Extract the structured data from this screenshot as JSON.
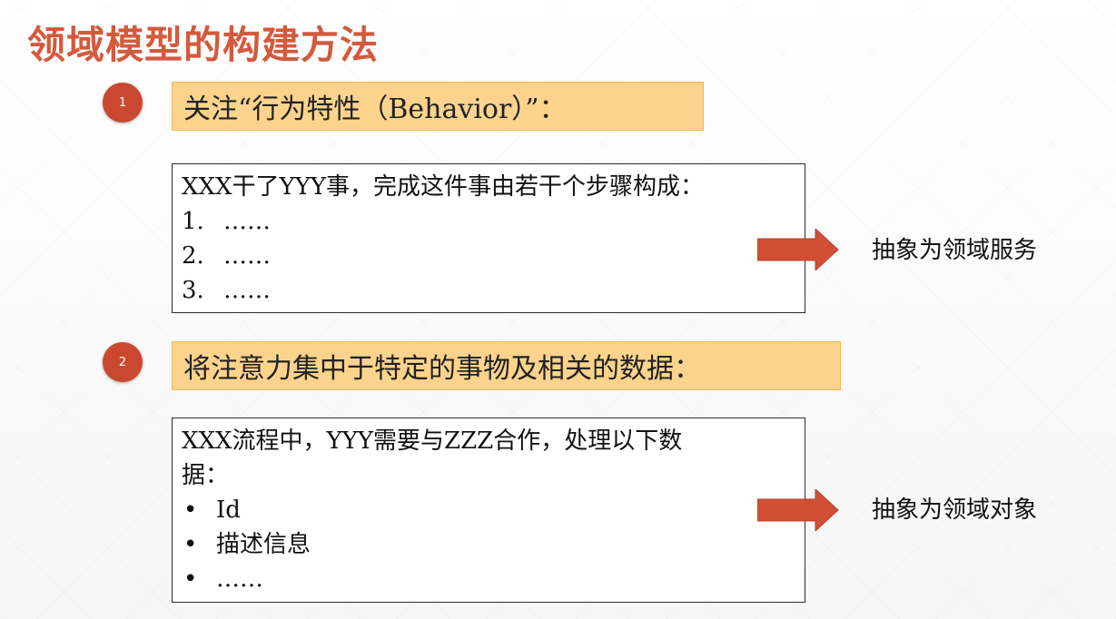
{
  "slide": {
    "title": "领域模型的构建方法"
  },
  "sections": [
    {
      "badge": "1",
      "heading": "关注“行为特性（Behavior）”：",
      "intro": "XXX干了YYY事，完成这件事由若干个步骤构成：",
      "items": [
        {
          "marker": "1.",
          "text": "……"
        },
        {
          "marker": "2.",
          "text": "……"
        },
        {
          "marker": "3.",
          "text": "……"
        }
      ],
      "result": "抽象为领域服务"
    },
    {
      "badge": "2",
      "heading": "将注意力集中于特定的事物及相关的数据：",
      "intro_line1": "XXX流程中，YYY需要与ZZZ合作，处理以下数",
      "intro_line2": "据：",
      "items": [
        {
          "marker": "•",
          "text": "Id"
        },
        {
          "marker": "•",
          "text": "描述信息"
        },
        {
          "marker": "•",
          "text": "……"
        }
      ],
      "result": "抽象为领域对象"
    }
  ],
  "colors": {
    "title": "#d35a3c",
    "badge": "#c9482f",
    "heading_fill": "#fbd38c",
    "heading_border": "#f3b755",
    "arrow": "#d04f35"
  }
}
